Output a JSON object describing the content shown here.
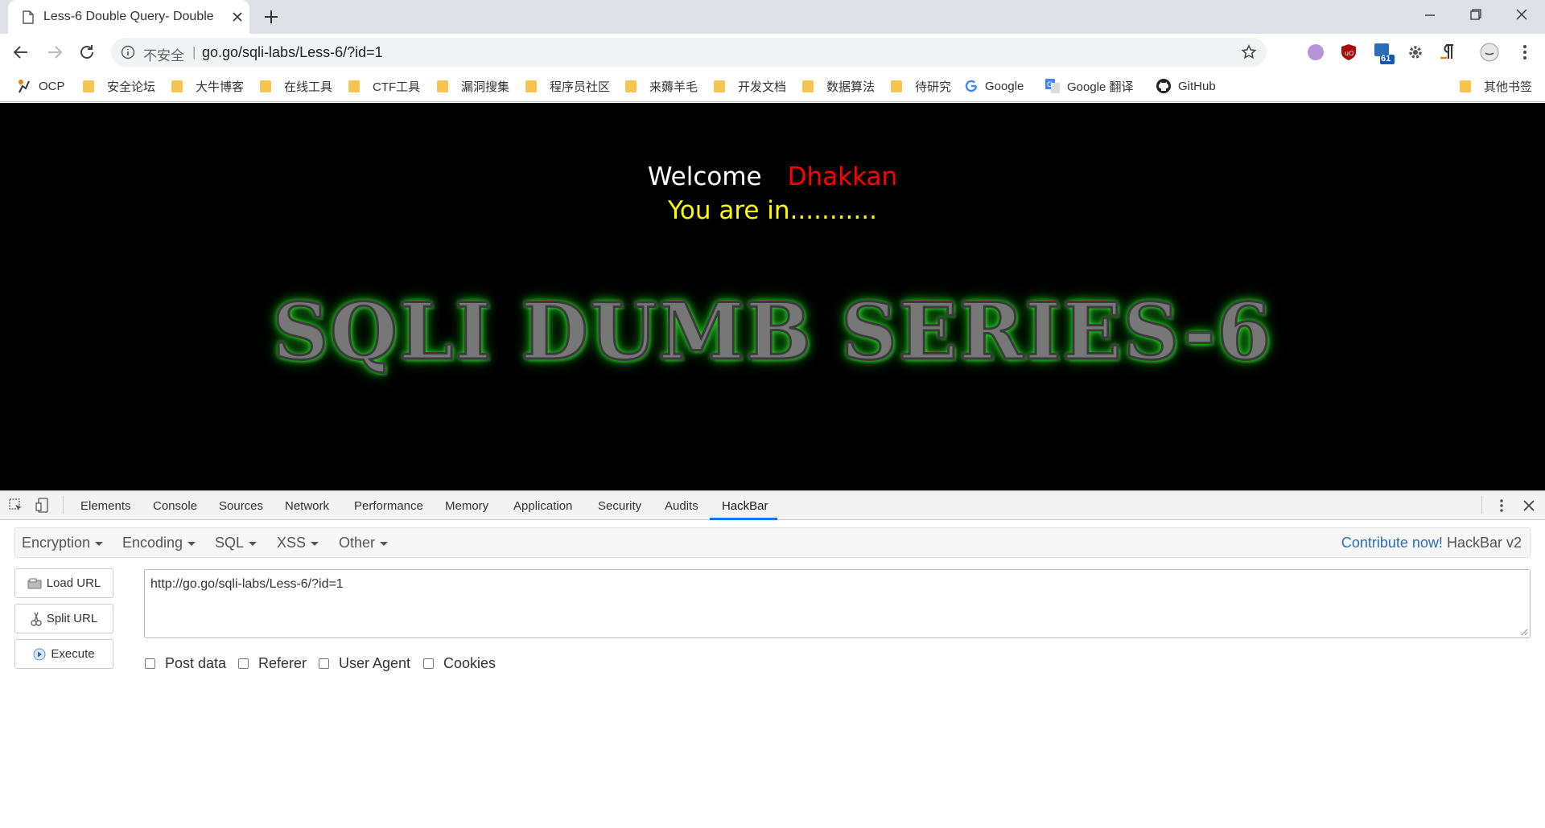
{
  "tab": {
    "title": "Less-6 Double Query- Double"
  },
  "omnibox": {
    "security_label": "不安全",
    "separator": "|",
    "url": "go.go/sqli-labs/Less-6/?id=1"
  },
  "extensions": {
    "badge_count": "61"
  },
  "bookmarks": {
    "items": [
      {
        "label": "OCP"
      },
      {
        "label": "安全论坛"
      },
      {
        "label": "大牛博客"
      },
      {
        "label": "在线工具"
      },
      {
        "label": "CTF工具"
      },
      {
        "label": "漏洞搜集"
      },
      {
        "label": "程序员社区"
      },
      {
        "label": "来薅羊毛"
      },
      {
        "label": "开发文档"
      },
      {
        "label": "数据算法"
      },
      {
        "label": "待研究"
      },
      {
        "label": "Google"
      },
      {
        "label": "Google 翻译"
      },
      {
        "label": "GitHub"
      }
    ],
    "other": "其他书签"
  },
  "page": {
    "welcome": "Welcome",
    "name": "Dhakkan",
    "status": "You are in...........",
    "banner": "SQLI DUMB SERIES-6"
  },
  "devtools": {
    "tabs": [
      "Elements",
      "Console",
      "Sources",
      "Network",
      "Performance",
      "Memory",
      "Application",
      "Security",
      "Audits",
      "HackBar"
    ],
    "active_tab": "HackBar"
  },
  "hackbar": {
    "menus": [
      "Encryption",
      "Encoding",
      "SQL",
      "XSS",
      "Other"
    ],
    "contribute": "Contribute now!",
    "version": "HackBar v2",
    "buttons": {
      "load": "Load URL",
      "split": "Split URL",
      "execute": "Execute"
    },
    "url_value": "http://go.go/sqli-labs/Less-6/?id=1",
    "checkboxes": [
      "Post data",
      "Referer",
      "User Agent",
      "Cookies"
    ]
  },
  "colors": {
    "welcome": "#ffffff",
    "name": "#ff0000",
    "status": "#ffff00",
    "banner_glow": "#2aff2a",
    "accent": "#1a73e8",
    "link": "#2a6ebb"
  }
}
